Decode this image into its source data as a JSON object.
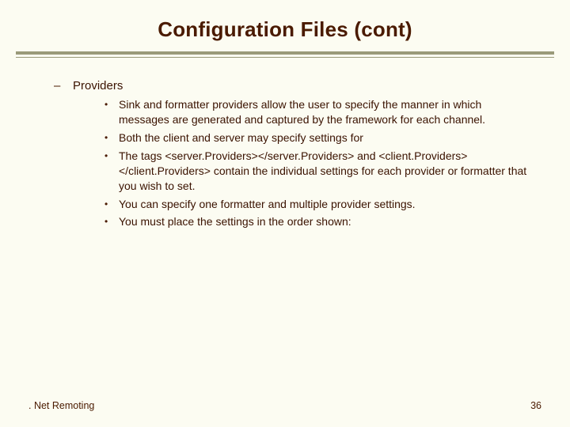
{
  "title": "Configuration Files (cont)",
  "section": {
    "heading": "Providers",
    "bullets": [
      "Sink and formatter providers allow the user to specify the manner in which messages are generated and captured by the framework for each channel.",
      "Both the client and server may specify settings for",
      "The tags <server.Providers></server.Providers> and <client.Providers></client.Providers> contain the individual settings for each provider or formatter that you wish to set.",
      "You can specify one formatter and multiple provider settings.",
      "You must place the settings in the order shown:"
    ]
  },
  "footer": {
    "left": ". Net Remoting",
    "right": "36"
  }
}
